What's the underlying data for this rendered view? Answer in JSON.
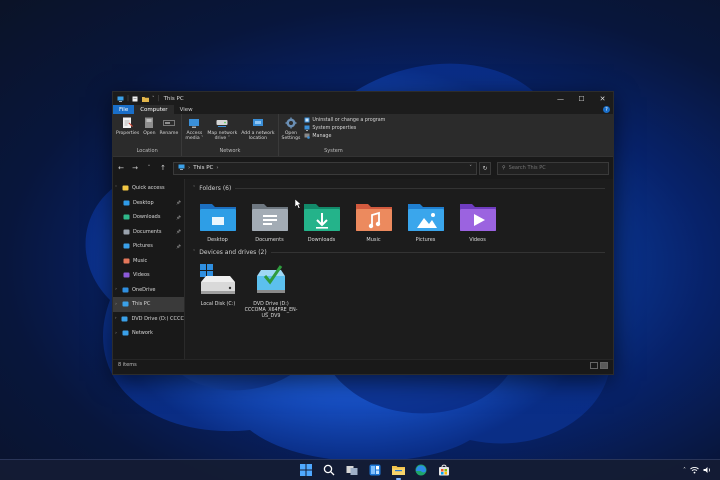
{
  "window": {
    "title": "This PC",
    "ribbon_tabs": [
      {
        "label": "File"
      },
      {
        "label": "Computer"
      },
      {
        "label": "View"
      }
    ],
    "ribbon_groups": {
      "location": {
        "label": "Location",
        "buttons": [
          {
            "label": "Properties",
            "icon": "properties-icon"
          },
          {
            "label": "Open",
            "icon": "open-icon"
          },
          {
            "label": "Rename",
            "icon": "rename-icon"
          }
        ]
      },
      "network": {
        "label": "Network",
        "buttons": [
          {
            "line1": "Access",
            "line2": "media ˅",
            "icon": "access-media-icon"
          },
          {
            "line1": "Map network",
            "line2": "drive ˅",
            "icon": "map-drive-icon"
          },
          {
            "line1": "Add a network",
            "line2": "location",
            "icon": "network-location-icon"
          }
        ]
      },
      "system": {
        "label": "System",
        "open_settings": {
          "line1": "Open",
          "line2": "Settings"
        },
        "items": [
          {
            "label": "Uninstall or change a program",
            "icon": "uninstall-icon"
          },
          {
            "label": "System properties",
            "icon": "system-properties-icon"
          },
          {
            "label": "Manage",
            "icon": "manage-icon"
          }
        ]
      }
    },
    "address": {
      "path": "This PC",
      "search_placeholder": "Search This PC"
    },
    "nav_pane": [
      {
        "label": "Quick access",
        "icon": "star-icon",
        "color": "#f2c744",
        "level": 0,
        "expander": "˅"
      },
      {
        "label": "Desktop",
        "icon": "desktop-icon",
        "color": "#2f9be8",
        "level": 1,
        "pinned": true
      },
      {
        "label": "Downloads",
        "icon": "downloads-icon",
        "color": "#2fb88a",
        "level": 1,
        "pinned": true
      },
      {
        "label": "Documents",
        "icon": "documents-icon",
        "color": "#9aa3ad",
        "level": 1,
        "pinned": true
      },
      {
        "label": "Pictures",
        "icon": "pictures-icon",
        "color": "#3aa0e8",
        "level": 1,
        "pinned": true
      },
      {
        "label": "Music",
        "icon": "music-icon",
        "color": "#e4775a",
        "level": 1
      },
      {
        "label": "Videos",
        "icon": "videos-icon",
        "color": "#8c5ad8",
        "level": 1
      },
      {
        "label": "OneDrive",
        "icon": "onedrive-icon",
        "color": "#2f8fe0",
        "level": 0,
        "expander": "›"
      },
      {
        "label": "This PC",
        "icon": "this-pc-icon",
        "color": "#3aa0e8",
        "level": 0,
        "expander": "›",
        "selected": true
      },
      {
        "label": "DVD Drive (D:) CCCC",
        "icon": "dvd-drive-icon",
        "color": "#3aa0e8",
        "level": 0,
        "expander": "›"
      },
      {
        "label": "Network",
        "icon": "network-icon",
        "color": "#3aa0e8",
        "level": 0,
        "expander": "›"
      }
    ],
    "folders_header": "Folders (6)",
    "folders": [
      {
        "label": "Desktop",
        "icon": "desktop-folder-icon",
        "color": "#2e9ee6",
        "accent": "#1c6fc0"
      },
      {
        "label": "Documents",
        "icon": "documents-folder-icon",
        "color": "#a3acb5",
        "accent": "#6e7780"
      },
      {
        "label": "Downloads",
        "icon": "downloads-folder-icon",
        "color": "#24b38a",
        "accent": "#128a6a"
      },
      {
        "label": "Music",
        "icon": "music-folder-icon",
        "color": "#ec8a5e",
        "accent": "#d25a3e"
      },
      {
        "label": "Pictures",
        "icon": "pictures-folder-icon",
        "color": "#3aa6ec",
        "accent": "#1f7fd0"
      },
      {
        "label": "Videos",
        "icon": "videos-folder-icon",
        "color": "#9b63e0",
        "accent": "#6f3cc0"
      }
    ],
    "drives_header": "Devices and drives (2)",
    "drives": [
      {
        "label": "Local Disk (C:)",
        "icon": "local-disk-icon"
      },
      {
        "label": "DVD Drive (D:) CCCOMA_X64FRE_EN-US_DV9",
        "icon": "dvd-drive-icon"
      }
    ],
    "status": "8 items"
  },
  "taskbar": {
    "apps": [
      "start-icon",
      "search-icon",
      "task-view-icon",
      "widgets-icon",
      "file-explorer-icon",
      "edge-icon",
      "store-icon"
    ]
  },
  "colors": {
    "accent": "#1a6fc9",
    "window_bg": "#191919",
    "ribbon_bg": "#2b2b2b"
  }
}
